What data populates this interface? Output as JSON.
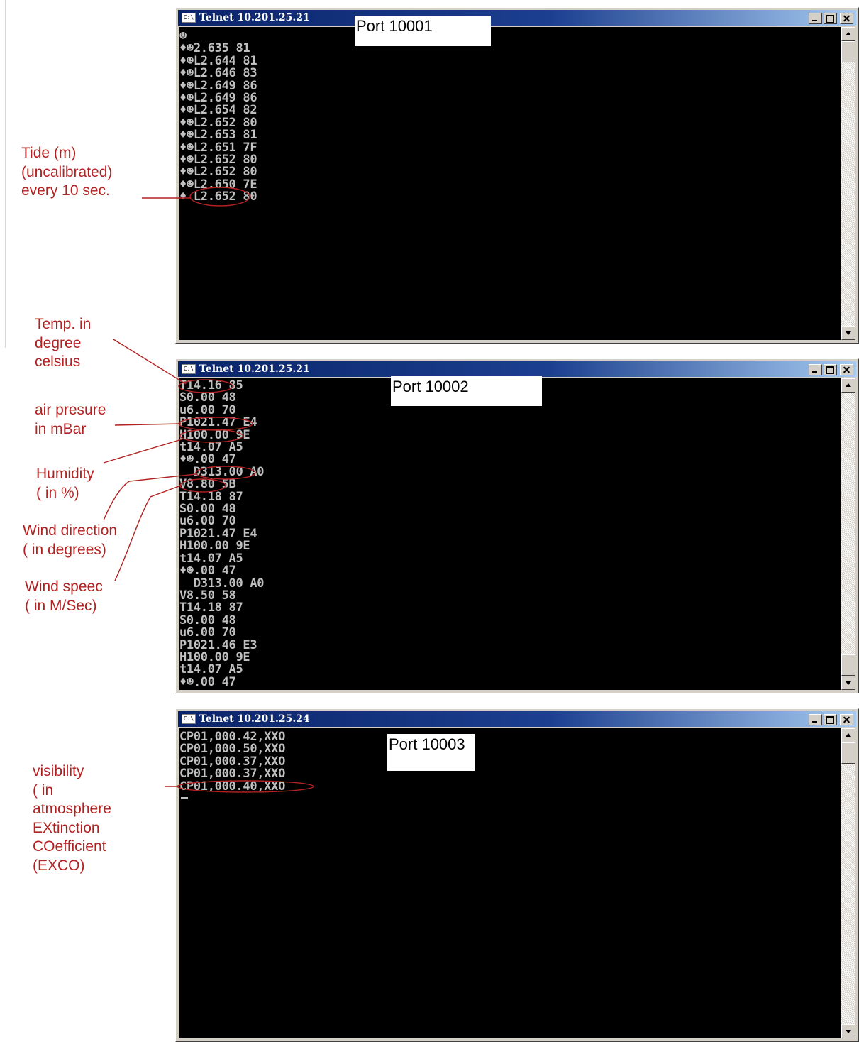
{
  "windows": [
    {
      "title": "Telnet 10.201.25.21",
      "port_label": "Port 10001",
      "lines": [
        "☻",
        "♦☻2.635 81",
        "♦☻L2.644 81",
        "♦☻L2.646 83",
        "♦☻L2.649 86",
        "♦☻L2.649 86",
        "♦☻L2.654 82",
        "♦☻L2.652 80",
        "♦☻L2.653 81",
        "♦☻L2.651 7F",
        "♦☻L2.652 80",
        "♦☻L2.652 80",
        "♦☻L2.650 7E",
        "♦ L2.652 80"
      ]
    },
    {
      "title": "Telnet 10.201.25.21",
      "port_label": "Port 10002",
      "lines": [
        "T14.16 85",
        "S0.00 48",
        "u6.00 70",
        "P1021.47 E4",
        "H100.00 9E",
        "t14.07 A5",
        "♦☻.00 47",
        "  D313.00 A0",
        "V8.80 5B",
        "T14.18 87",
        "S0.00 48",
        "u6.00 70",
        "P1021.47 E4",
        "H100.00 9E",
        "t14.07 A5",
        "♦☻.00 47",
        "  D313.00 A0",
        "V8.50 58",
        "T14.18 87",
        "S0.00 48",
        "u6.00 70",
        "P1021.46 E3",
        "H100.00 9E",
        "t14.07 A5",
        "♦☻.00 47"
      ]
    },
    {
      "title": "Telnet 10.201.25.24",
      "port_label": "Port 10003",
      "lines": [
        "CP01,000.42,XXO",
        "CP01,000.50,XXO",
        "CP01,000.37,XXO",
        "CP01,000.37,XXO",
        "CP01,000.40,XXO"
      ]
    }
  ],
  "annotations": {
    "tide": [
      "Tide (m)",
      "(uncalibrated)",
      "every 10 sec."
    ],
    "temp": [
      "Temp. in",
      "degree",
      "celsius"
    ],
    "air": [
      "air presure",
      "in mBar"
    ],
    "humidity": [
      "Humidity",
      "( in %)"
    ],
    "wind_direction": [
      "Wind direction",
      "( in degrees)"
    ],
    "wind_speed": [
      "Wind speec",
      "( in M/Sec)"
    ],
    "visibility": [
      "visibility",
      "( in",
      "atmosphere",
      " EXtinction",
      " COefficient",
      "(EXCO)"
    ]
  },
  "colors": {
    "annotation": "#b22222",
    "console_bg": "#000000",
    "console_text": "#c0c0c0",
    "titlebar": "#0a246a"
  },
  "icons": {
    "window_icon": "command-prompt-icon"
  }
}
